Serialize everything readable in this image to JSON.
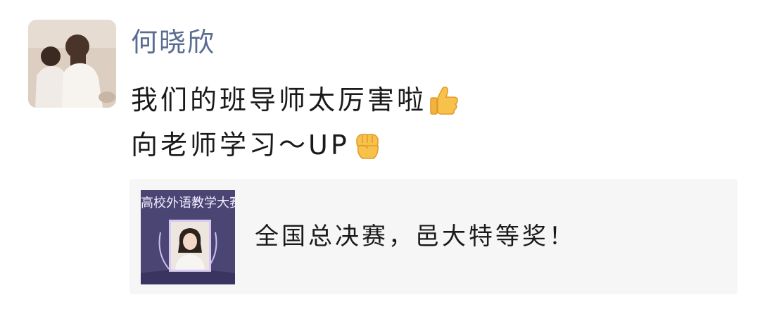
{
  "post": {
    "poster_name": "何晓欣",
    "avatar_icon": "avatar-photo-two-children",
    "lines": [
      {
        "text": "我们的班导师太厉害啦",
        "emoji": "thumbs-up-icon"
      },
      {
        "text": "向老师学习～UP",
        "emoji": "raised-fist-icon"
      }
    ]
  },
  "share_card": {
    "thumbnail_banner": "高校外语教学大赛颁",
    "title": "全国总决赛，邑大特等奖！"
  },
  "colors": {
    "name": "#596c91",
    "text": "#1a1a1a",
    "card_bg": "#f6f6f6",
    "thumb_bg": "#4a4573"
  }
}
